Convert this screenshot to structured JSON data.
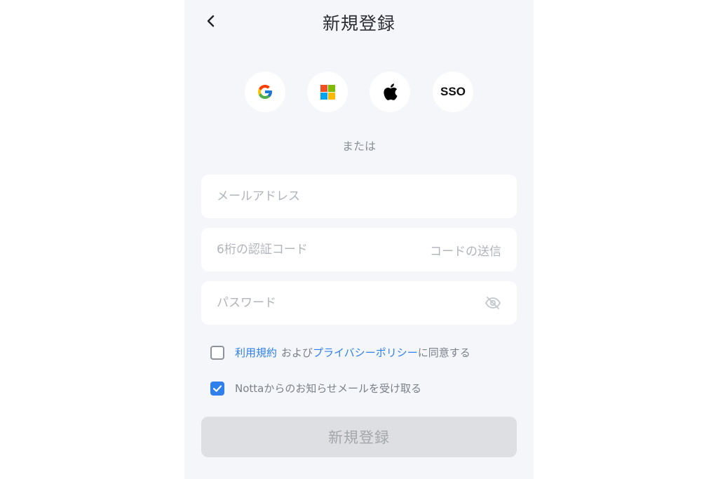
{
  "header": {
    "title": "新規登録",
    "back_icon": "chevron-left-icon"
  },
  "social_login": [
    {
      "name": "google",
      "icon": "google-icon"
    },
    {
      "name": "microsoft",
      "icon": "microsoft-icon"
    },
    {
      "name": "apple",
      "icon": "apple-icon"
    },
    {
      "name": "sso",
      "label": "SSO"
    }
  ],
  "divider_text": "または",
  "form": {
    "email_placeholder": "メールアドレス",
    "code_placeholder": "6桁の認証コード",
    "send_code_label": "コードの送信",
    "password_placeholder": "パスワード",
    "password_toggle_icon": "eye-off-icon"
  },
  "agreements": {
    "terms": {
      "checked": false,
      "terms_link": "利用規約",
      "and_text": "および",
      "privacy_link": "プライバシーポリシー",
      "suffix": "に同意する"
    },
    "newsletter": {
      "checked": true,
      "label": "Nottaからのお知らせメールを受け取る"
    }
  },
  "submit_label": "新規登録",
  "colors": {
    "accent": "#2f80ed",
    "background": "#f4f6f9",
    "disabled_button": "#dddfe2"
  }
}
